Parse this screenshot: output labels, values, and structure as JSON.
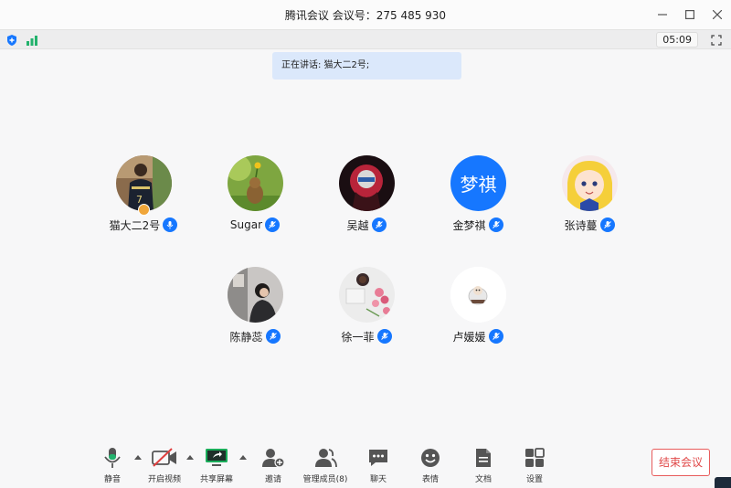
{
  "window": {
    "title": "腾讯会议 会议号：275 485 930",
    "minimize_icon": "minimize-icon",
    "maximize_icon": "maximize-icon",
    "close_icon": "close-icon"
  },
  "status_bar": {
    "timer": "05:09",
    "security_icon": "shield-icon",
    "signal_icon": "signal-bars-icon",
    "fullscreen_icon": "fullscreen-icon"
  },
  "speaking_banner": "正在讲话: 猫大二2号;",
  "participants": [
    {
      "name": "猫大二2号",
      "avatar": "photo",
      "is_host": true,
      "mic": "speaking"
    },
    {
      "name": "Sugar",
      "avatar": "photo",
      "is_host": false,
      "mic": "muted"
    },
    {
      "name": "吴越",
      "avatar": "photo",
      "is_host": false,
      "mic": "muted"
    },
    {
      "name": "金梦祺",
      "avatar_text": "梦祺",
      "avatar_color": "#1677ff",
      "is_host": false,
      "mic": "muted"
    },
    {
      "name": "张诗蔓",
      "avatar": "photo",
      "is_host": false,
      "mic": "muted"
    },
    {
      "name": "陈静蕊",
      "avatar": "photo",
      "is_host": false,
      "mic": "muted"
    },
    {
      "name": "徐一菲",
      "avatar": "photo",
      "is_host": false,
      "mic": "muted"
    },
    {
      "name": "卢媛媛",
      "avatar": "photo",
      "is_host": false,
      "mic": "muted"
    }
  ],
  "toolbar": {
    "mute": "静音",
    "video": "开启视频",
    "share": "共享屏幕",
    "invite": "邀请",
    "members": "管理成员(8)",
    "chat": "聊天",
    "emoji": "表情",
    "docs": "文档",
    "settings": "设置",
    "end_meeting": "结束会议"
  },
  "colors": {
    "accent": "#1677ff",
    "danger": "#e04848",
    "share_green": "#1aad5a",
    "video_off_red": "#e03e3e"
  }
}
